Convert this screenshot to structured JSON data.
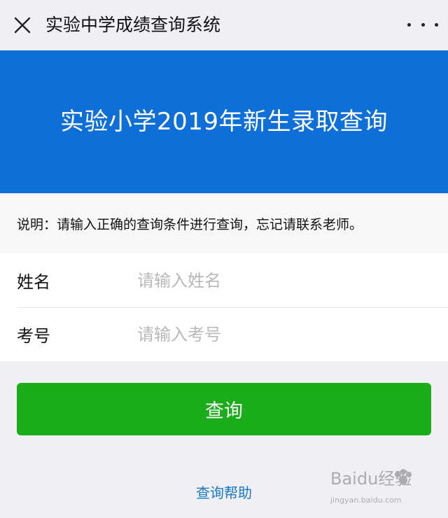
{
  "header": {
    "title": "实验中学成绩查询系统"
  },
  "icons": {
    "close": "close-icon",
    "more": "more-dots-icon"
  },
  "banner": {
    "title": "实验小学2019年新生录取查询",
    "color": "#0f6fd8"
  },
  "description": {
    "text": "说明：请输入正确的查询条件进行查询，忘记请联系老师。"
  },
  "form": {
    "name_label": "姓名",
    "name_placeholder": "请输入姓名",
    "exam_label": "考号",
    "exam_placeholder": "请输入考号"
  },
  "actions": {
    "submit_label": "查询",
    "submit_color": "#1aad19",
    "help_label": "查询帮助",
    "help_color": "#1479c8"
  },
  "watermark": {
    "brand": "Baidu经验",
    "url": "jingyan.baidu.com"
  }
}
